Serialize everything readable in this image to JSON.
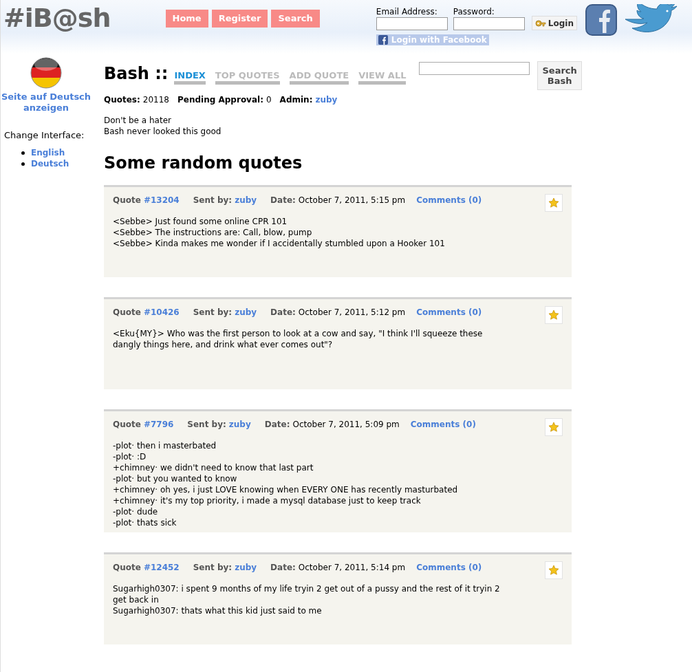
{
  "header": {
    "logo": "#iB@sh",
    "nav": [
      "Home",
      "Register",
      "Search"
    ],
    "login": {
      "email_label": "Email Address:",
      "password_label": "Password:",
      "button": "Login",
      "facebook_button": "Login with Facebook"
    }
  },
  "sidebar": {
    "language_link": "Seite auf Deutsch anzeigen",
    "interface_label": "Change Interface:",
    "interfaces": [
      "English",
      "Deutsch"
    ]
  },
  "main": {
    "title": "Bash ::",
    "tabs": [
      {
        "label": "INDEX",
        "selected": true
      },
      {
        "label": "TOP QUOTES",
        "selected": false
      },
      {
        "label": "ADD QUOTE",
        "selected": false
      },
      {
        "label": "VIEW ALL",
        "selected": false
      }
    ],
    "search_button": "Search Bash",
    "stats": [
      {
        "label": "Quotes:",
        "value": "20118",
        "kind": "text"
      },
      {
        "label": "Pending Approval:",
        "value": "0",
        "kind": "text"
      },
      {
        "label": "Admin:",
        "value": "zuby",
        "kind": "link"
      }
    ],
    "tagline": [
      "Don't be a hater",
      "Bash never looked this good"
    ],
    "section_title": "Some random quotes",
    "quotes": [
      {
        "label": "Quote",
        "number": "#13204",
        "sent_label": "Sent by:",
        "sender": "zuby",
        "date_label": "Date:",
        "date": "October 7, 2011, 5:15 pm",
        "comments": "Comments (0)",
        "lines": [
          "<Sebbe> Just found some online CPR 101",
          "<Sebbe> The instructions are: Call, blow, pump",
          "<Sebbe> Kinda makes me wonder if I accidentally stumbled upon a Hooker 101"
        ]
      },
      {
        "label": "Quote",
        "number": "#10426",
        "sent_label": "Sent by:",
        "sender": "zuby",
        "date_label": "Date:",
        "date": "October 7, 2011, 5:12 pm",
        "comments": "Comments (0)",
        "lines": [
          "<Eku{MY}> Who was the first person to look at a cow and say, \"I think I'll squeeze these dangly things here, and drink what ever comes out\"?"
        ]
      },
      {
        "label": "Quote",
        "number": "#7796",
        "sent_label": "Sent by:",
        "sender": "zuby",
        "date_label": "Date:",
        "date": "October 7, 2011, 5:09 pm",
        "comments": "Comments (0)",
        "lines": [
          "-plot· then i masterbated",
          "-plot· :D",
          "+chimney· we didn't need to know that last part",
          "-plot· but you wanted to know",
          "+chimney· oh yes, i just LOVE knowing when EVERY ONE has recently masturbated",
          "+chimney· it's my top priority, i made a mysql database just to keep track",
          "-plot· dude",
          "-plot· thats sick"
        ]
      },
      {
        "label": "Quote",
        "number": "#12452",
        "sent_label": "Sent by:",
        "sender": "zuby",
        "date_label": "Date:",
        "date": "October 7, 2011, 5:14 pm",
        "comments": "Comments (0)",
        "lines": [
          "Sugarhigh0307: i spent 9 months of my life tryin 2 get out of a pussy and the rest of it tryin 2 get back in",
          "Sugarhigh0307: thats what this kid just said to me"
        ]
      }
    ]
  }
}
